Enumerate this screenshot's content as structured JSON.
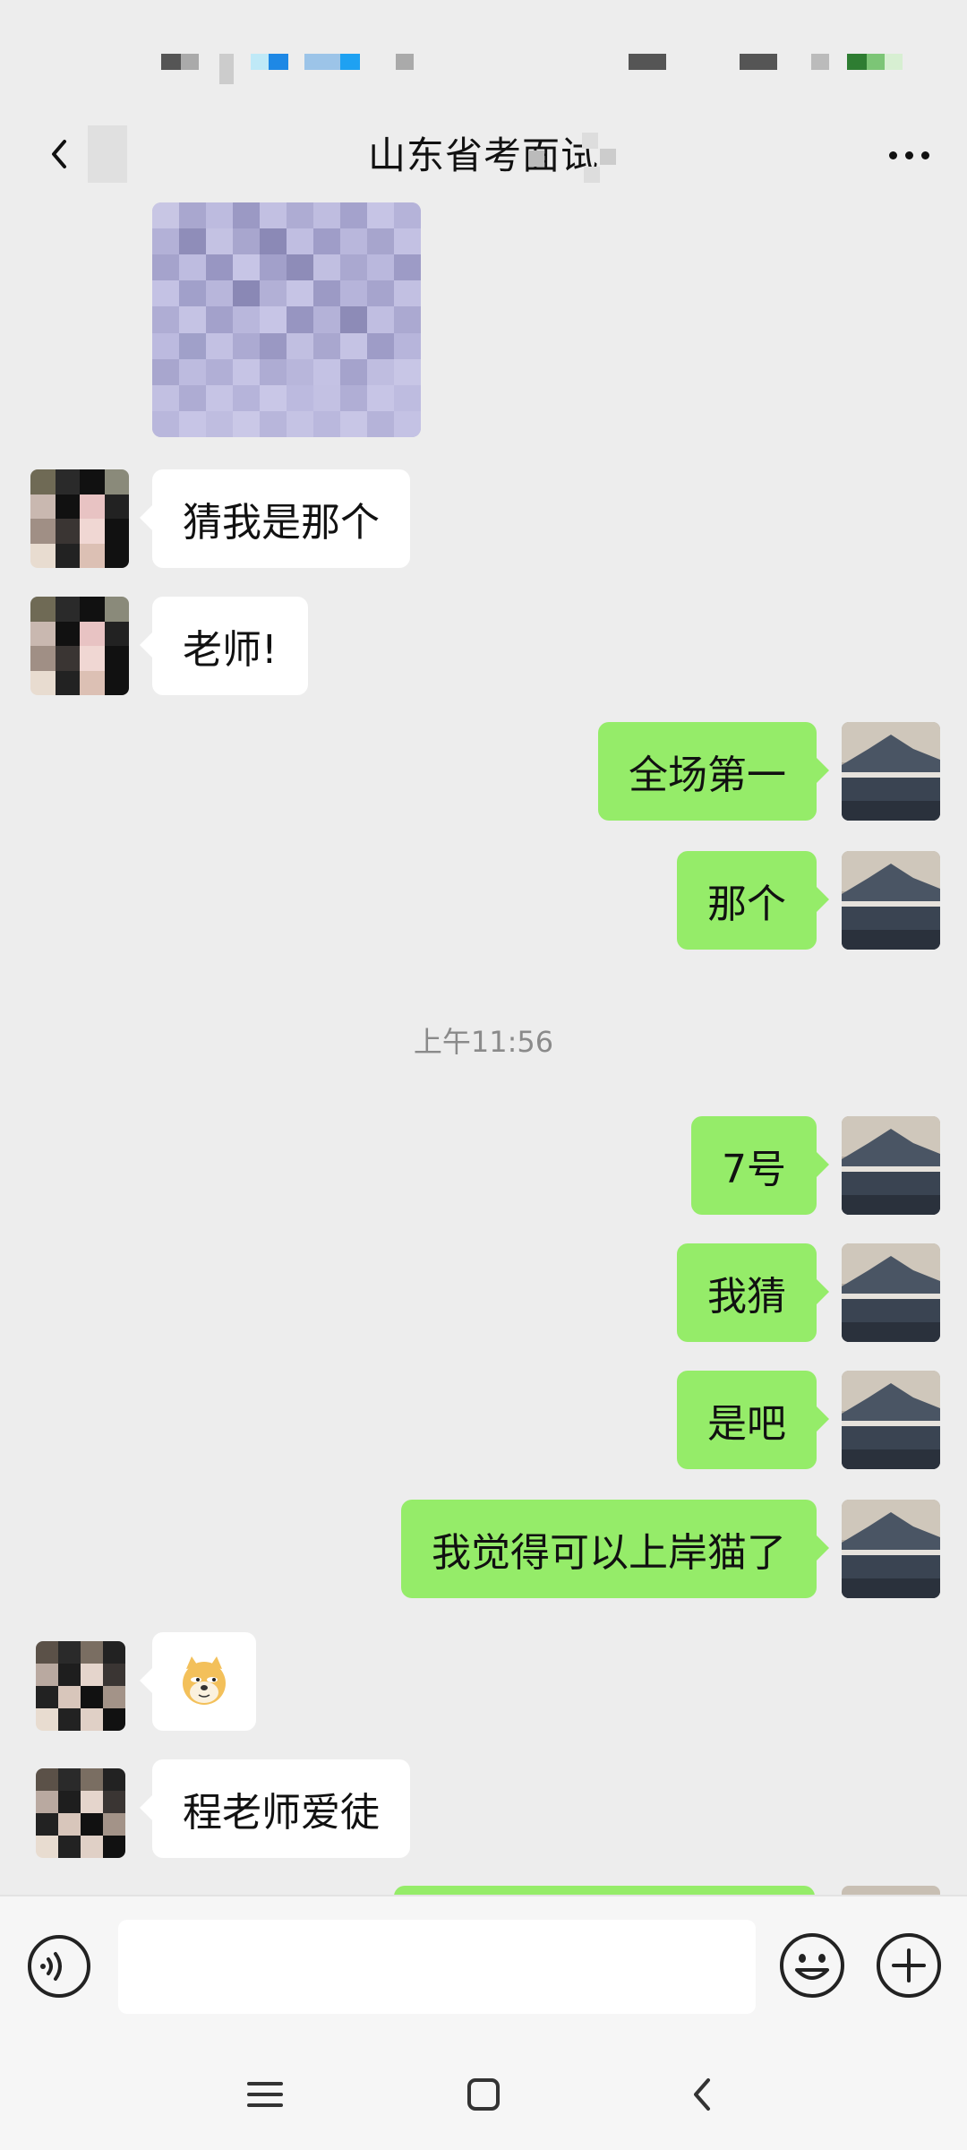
{
  "header": {
    "title": "山东省考面试",
    "back_icon": "chevron-left-icon",
    "more_icon": "more-dots-icon"
  },
  "messages": [
    {
      "side": "in",
      "text": "猜我是那个"
    },
    {
      "side": "in",
      "text": "老师!"
    },
    {
      "side": "out",
      "text": "全场第一"
    },
    {
      "side": "out",
      "text": "那个"
    },
    {
      "side": "out",
      "text": "7号"
    },
    {
      "side": "out",
      "text": "我猜"
    },
    {
      "side": "out",
      "text": "是吧"
    },
    {
      "side": "out",
      "text": "我觉得可以上岸猫了"
    },
    {
      "side": "in",
      "text": "doge-emoji"
    },
    {
      "side": "in",
      "text": "程老师爱徒"
    }
  ],
  "timestamp": "上午11:56",
  "input": {
    "placeholder": "",
    "value": ""
  },
  "colors": {
    "background": "#ededed",
    "incoming_bubble": "#ffffff",
    "outgoing_bubble": "#95ec69",
    "timestamp": "#8a8a8a"
  },
  "icons": {
    "voice": "voice-icon",
    "emoji": "emoji-icon",
    "plus": "plus-icon",
    "nav_menu": "menu-icon",
    "nav_home": "home-icon",
    "nav_back": "back-icon"
  }
}
